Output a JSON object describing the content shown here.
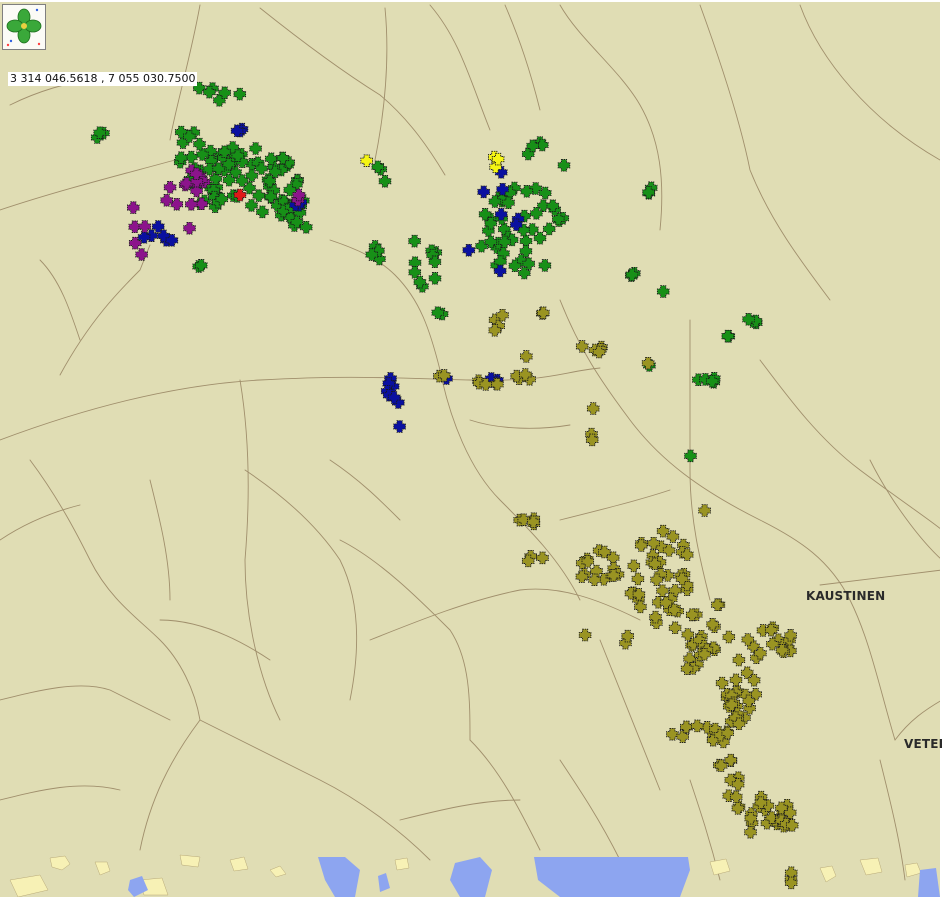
{
  "coordinates": "3 314 046.5618 , 7 055 030.7500",
  "logo": {
    "icon": "four-leaf-clover-icon"
  },
  "place_labels": {
    "kaustinen": "KAUSTINEN",
    "veteli": "VETEL"
  },
  "colors": {
    "background": "#e0ddb4",
    "road": "#a08f6c",
    "water": "#8da5f0",
    "field": "#f7f1b5",
    "green_markers": "#179017",
    "olive_markers": "#9a9422",
    "blue_markers": "#0a10a0",
    "purple_markers": "#8c148c",
    "yellow_markers": "#f5f514",
    "red_marker": "#e01818"
  },
  "marker_groups": [
    {
      "name": "green",
      "color": "#179017",
      "count": 179
    },
    {
      "name": "olive",
      "color": "#9a9422",
      "count": 253
    },
    {
      "name": "blue",
      "color": "#0a10a0",
      "count": 32
    },
    {
      "name": "purple",
      "color": "#8c148c",
      "count": 24
    },
    {
      "name": "yellow",
      "color": "#f5f514",
      "count": 4
    },
    {
      "name": "red",
      "color": "#e01818",
      "count": 1
    }
  ]
}
